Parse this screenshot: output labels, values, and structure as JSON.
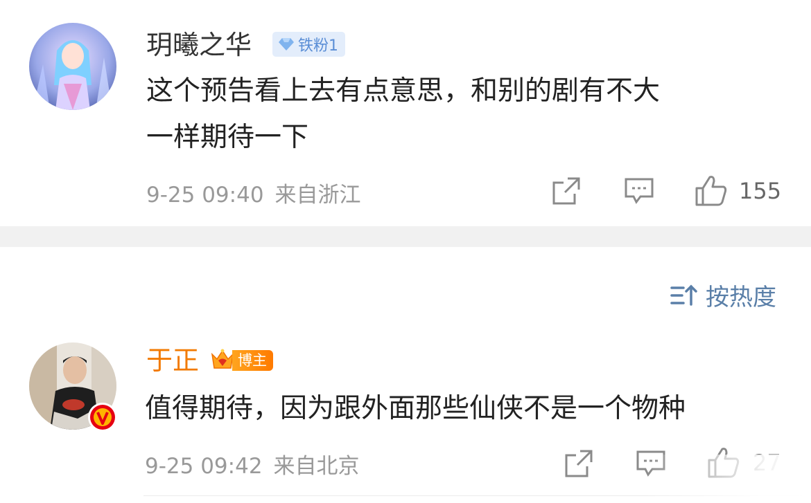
{
  "comments": [
    {
      "username": "玥曦之华",
      "badge": "铁粉1",
      "content_lines": [
        "这个预告看上去有点意思，和别的剧有不大",
        "一样期待一下"
      ],
      "time": "9-25 09:40",
      "location": "来自浙江",
      "likes": "155"
    },
    {
      "username": "于正",
      "badge": "博主",
      "content": "值得期待，因为跟外面那些仙侠不是一个物种",
      "time": "9-25 09:42",
      "location": "来自北京",
      "likes": "27"
    }
  ],
  "sort": {
    "label": "按热度"
  },
  "icons": [
    "share-icon",
    "comment-icon",
    "like-icon",
    "sort-icon",
    "diamond-icon",
    "crown-icon",
    "verified-v-icon"
  ],
  "colors": {
    "blogger_name": "#f27a00",
    "sort_blue": "#5a7fa8",
    "fan_badge_bg": "#e3edfb",
    "fan_badge_text": "#5a8ed6"
  }
}
